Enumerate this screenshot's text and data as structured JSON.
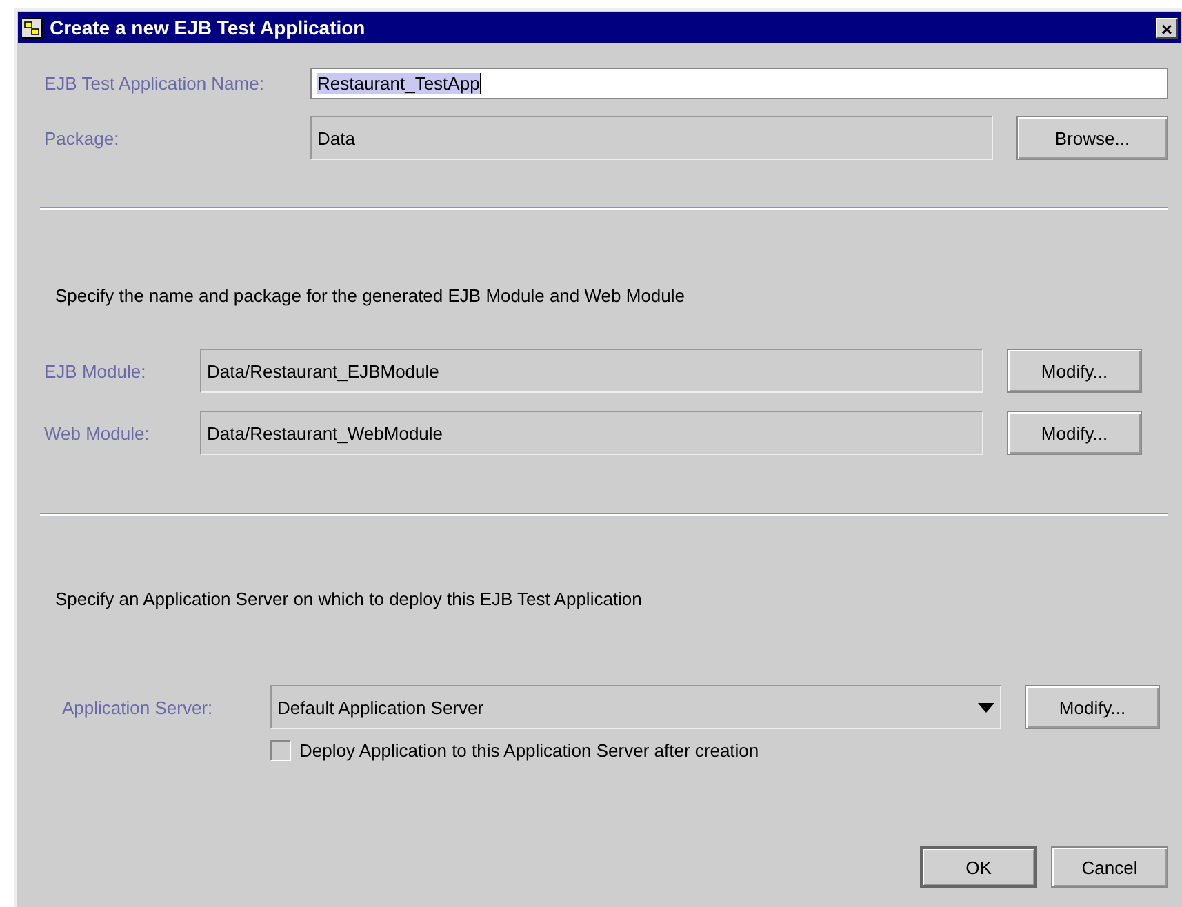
{
  "window": {
    "title": "Create a new EJB Test Application",
    "close": "×"
  },
  "application": {
    "name_label": "EJB Test Application Name:",
    "name_value": "Restaurant_TestApp",
    "name_text_selected": true,
    "package_label": "Package:",
    "package_value": "Data",
    "package_disabled": true,
    "browse_button": "Browse..."
  },
  "modules": {
    "instruction": "Specify the name and package for the generated EJB Module and Web Module",
    "rows": [
      {
        "label": "EJB Module:",
        "value": "Data/Restaurant_EJBModule",
        "button": "Modify..."
      },
      {
        "label": "Web Module:",
        "value": "Data/Restaurant_WebModule",
        "button": "Modify..."
      }
    ]
  },
  "server": {
    "instruction": "Specify an Application Server on which to deploy this EJB Test Application",
    "label": "Application Server:",
    "value": "Default Application Server",
    "button": "Modify...",
    "deploy_label": "Deploy Application to this Application Server after creation",
    "deploy_checked": false
  },
  "buttons": [
    {
      "label": "OK",
      "default": true
    },
    {
      "label": "Cancel",
      "default": false
    }
  ]
}
